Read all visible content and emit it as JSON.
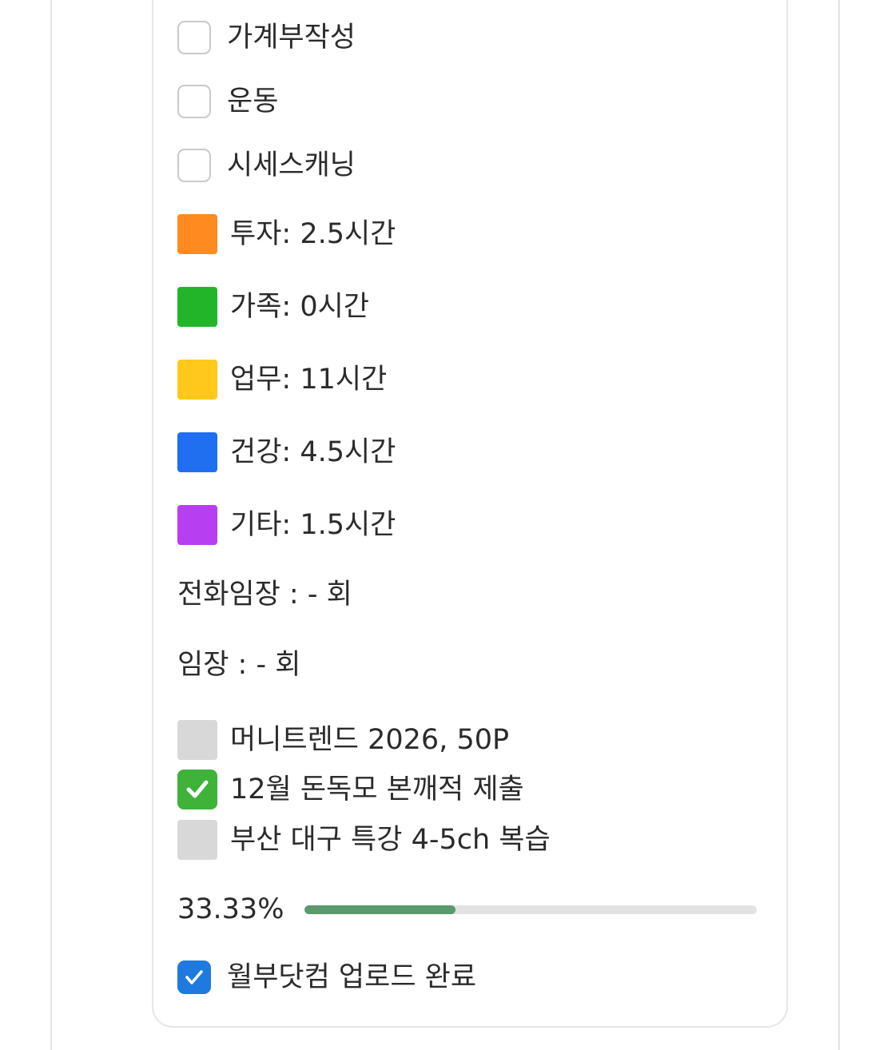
{
  "checklist": [
    {
      "label": "가계부작성",
      "checked": false
    },
    {
      "label": "운동",
      "checked": false
    },
    {
      "label": "시세스캐닝",
      "checked": false
    }
  ],
  "time_log": [
    {
      "label": "투자: 2.5시간",
      "color": "#ff8a1f",
      "icon": "orange-square-icon"
    },
    {
      "label": "가족: 0시간",
      "color": "#22b52a",
      "icon": "green-square-icon"
    },
    {
      "label": "업무: 11시간",
      "color": "#ffc81a",
      "icon": "yellow-square-icon"
    },
    {
      "label": "건강: 4.5시간",
      "color": "#1f6ff0",
      "icon": "blue-square-icon"
    },
    {
      "label": "기타: 1.5시간",
      "color": "#b83ef2",
      "icon": "purple-square-icon"
    }
  ],
  "counts": {
    "phone_visit": "전화임장 : - 회",
    "visit": "임장 : - 회"
  },
  "tasks": [
    {
      "label": "머니트렌드 2026, 50P",
      "done": false,
      "icon": "gray-square-icon"
    },
    {
      "label": "12월 돈독모 본깨적 제출",
      "done": true,
      "icon": "check-mark-button-icon"
    },
    {
      "label": "부산 대구 특강 4-5ch 복습",
      "done": false,
      "icon": "gray-square-icon"
    }
  ],
  "progress": {
    "text": "33.33%",
    "fraction": 0.3333,
    "fill_color": "#5a9a6c"
  },
  "final_item": {
    "label": "월부닷컴 업로드 완료",
    "checked": true,
    "accent": "#1f7ae0"
  }
}
